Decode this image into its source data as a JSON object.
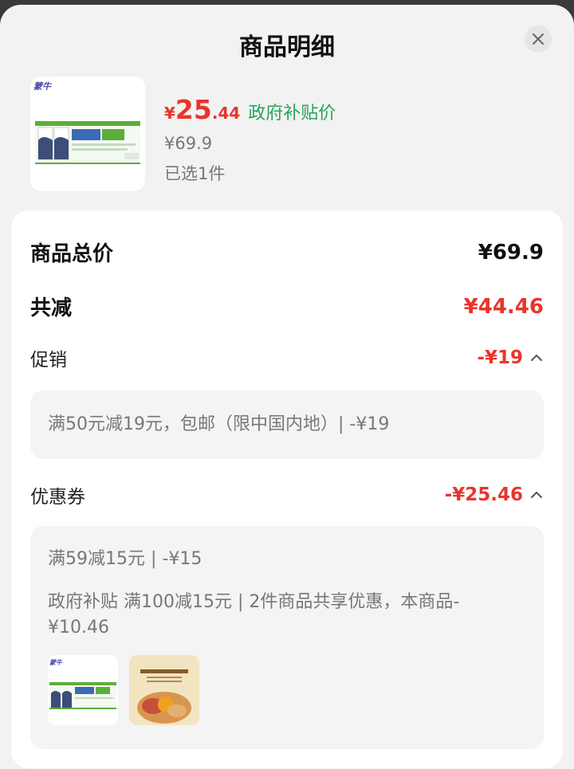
{
  "header": {
    "title": "商品明细"
  },
  "product": {
    "currency_symbol": "¥",
    "price_integer": "25",
    "price_decimal": ".44",
    "price_tag": "政府补贴价",
    "original_price": "¥69.9",
    "selected_count": "已选1件"
  },
  "summary": {
    "total_label": "商品总价",
    "total_value": "¥69.9",
    "reduction_label": "共减",
    "reduction_value": "¥44.46"
  },
  "promotion": {
    "label": "促销",
    "value": "-¥19",
    "details": [
      "满50元减19元，包邮（限中国内地）| -¥19"
    ]
  },
  "coupon": {
    "label": "优惠券",
    "value": "-¥25.46",
    "details": [
      "满59减15元 | -¥15",
      "政府补贴 满100减15元 | 2件商品共享优惠，本商品-¥10.46"
    ]
  },
  "colors": {
    "accent_red": "#e8352b",
    "green": "#2aa35a"
  }
}
